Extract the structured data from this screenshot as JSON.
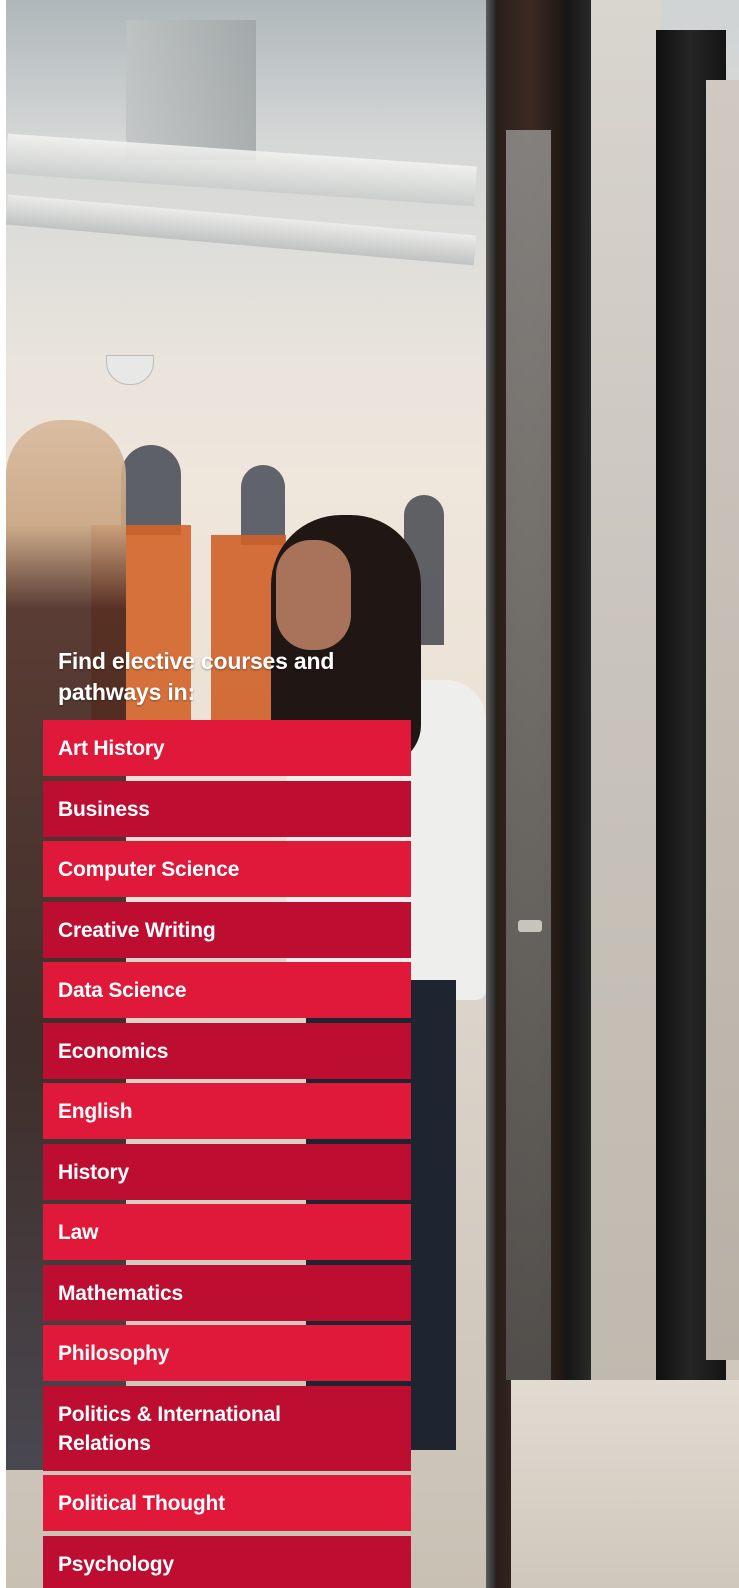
{
  "promo": {
    "title": "Find elective courses and pathways in:"
  },
  "courses": [
    {
      "label": "Art History"
    },
    {
      "label": "Business"
    },
    {
      "label": "Computer Science"
    },
    {
      "label": "Creative Writing"
    },
    {
      "label": "Data Science"
    },
    {
      "label": "Economics"
    },
    {
      "label": "English"
    },
    {
      "label": "History"
    },
    {
      "label": "Law"
    },
    {
      "label": "Mathematics"
    },
    {
      "label": "Philosophy"
    },
    {
      "label": "Politics & International Relations"
    },
    {
      "label": "Political Thought"
    },
    {
      "label": "Psychology"
    }
  ],
  "colors": {
    "primary_red": "#e0193a",
    "dark_red": "#bd0e31",
    "text": "#ffffff"
  }
}
